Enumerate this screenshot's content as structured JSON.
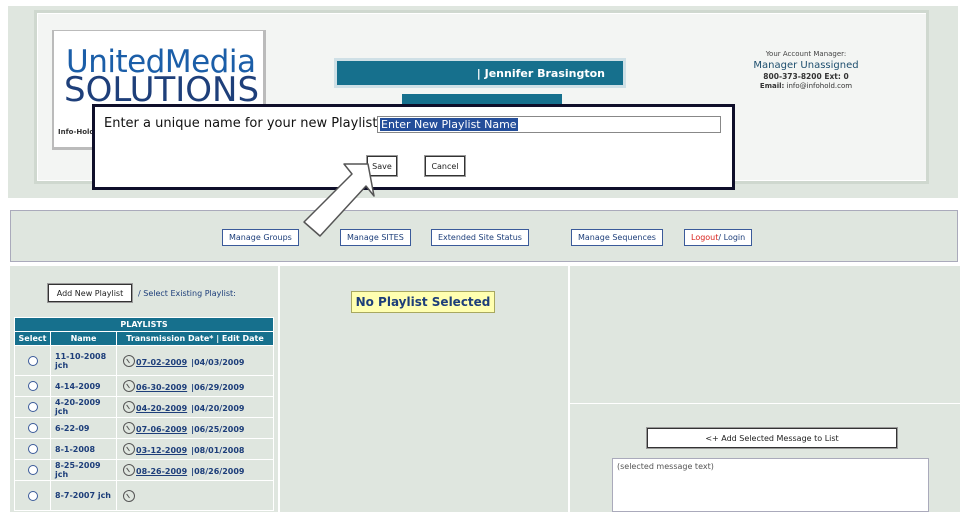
{
  "header": {
    "logo_line1_a": "United",
    "logo_line1_b": "Media",
    "logo_line2": "SOLUTIONS",
    "logo_sub": "Info-Hold",
    "user_name": "| Jennifer Brasington",
    "account": {
      "title": "Your Account Manager:",
      "manager": "Manager Unassigned",
      "phone": "800-373-8200 Ext: 0",
      "email_label": "Email:",
      "email": "info@infohold.com"
    }
  },
  "dialog": {
    "prompt": "Enter a unique name for your new Playlist:",
    "input_value": "Enter New Playlist Name",
    "save_label": "Save",
    "cancel_label": "Cancel"
  },
  "nav": {
    "manage_groups": "Manage Groups",
    "manage_sites": "Manage SITES",
    "extended_status": "Extended Site Status",
    "manage_sequences": "Manage Sequences",
    "logout": "Logout",
    "login": " / Login"
  },
  "playlists": {
    "add_new_label": "Add New Playlist",
    "select_existing": "/ Select Existing Playlist:",
    "title": "PLAYLISTS",
    "col_select": "Select",
    "col_name": "Name",
    "col_dates": "Transmission Date* | Edit Date",
    "rows": [
      {
        "name": "11-10-2008 jch",
        "tdate": "07-02-2009",
        "edate": "|04/03/2009"
      },
      {
        "name": "4-14-2009",
        "tdate": "06-30-2009",
        "edate": "|06/29/2009"
      },
      {
        "name": "4-20-2009 jch",
        "tdate": "04-20-2009",
        "edate": "|04/20/2009"
      },
      {
        "name": "6-22-09",
        "tdate": "07-06-2009",
        "edate": "|06/25/2009"
      },
      {
        "name": "8-1-2008",
        "tdate": "03-12-2009",
        "edate": "|08/01/2008"
      },
      {
        "name": "8-25-2009 jch",
        "tdate": "08-26-2009",
        "edate": "|08/26/2009"
      },
      {
        "name": "8-7-2007 jch",
        "tdate": "",
        "edate": ""
      }
    ]
  },
  "main": {
    "no_playlist": "No Playlist Selected",
    "add_message_label": "<+ Add Selected Message to List",
    "selected_message_text": "(selected message text)"
  },
  "colors": {
    "teal": "#16708d",
    "panel_bg": "#dfe6df",
    "highlight_yellow": "#ffffb0",
    "logout_red": "#d9231d"
  }
}
